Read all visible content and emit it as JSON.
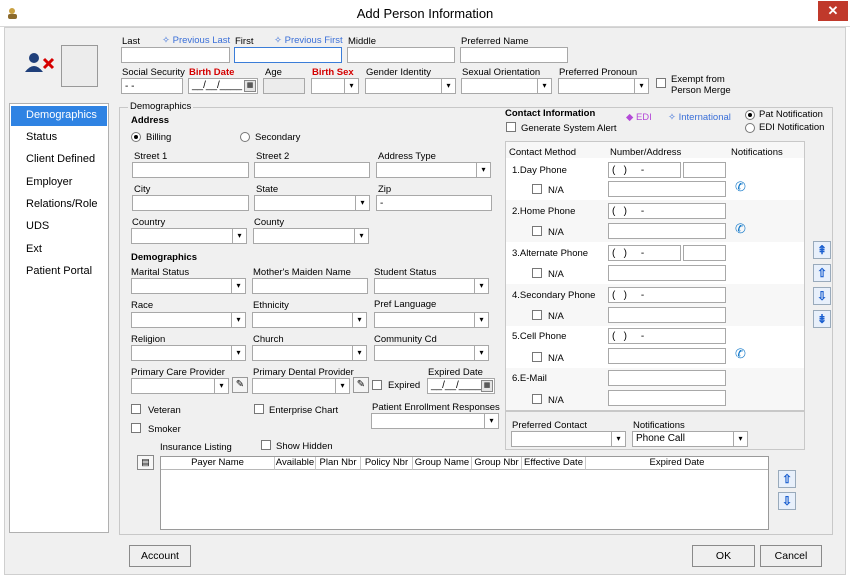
{
  "window": {
    "title": "Add Person Information",
    "close": "✕"
  },
  "top": {
    "last_label": "Last",
    "prev_last": "Previous Last",
    "first_label": "First",
    "prev_first": "Previous First",
    "middle_label": "Middle",
    "preferred_name_label": "Preferred Name",
    "ssn_label": "Social Security",
    "ssn_value": "- -",
    "birth_date_label": "Birth Date",
    "birth_date_value": "__/__/____",
    "age_label": "Age",
    "birth_sex_label": "Birth Sex",
    "gender_identity_label": "Gender Identity",
    "sexual_orientation_label": "Sexual Orientation",
    "preferred_pronoun_label": "Preferred Pronoun",
    "exempt_label": "Exempt from",
    "exempt_label2": "Person Merge"
  },
  "sidebar": {
    "items": [
      "Demographics",
      "Status",
      "Client Defined",
      "Employer",
      "Relations/Role",
      "UDS",
      "Ext",
      "Patient Portal"
    ]
  },
  "demo": {
    "group_label": "Demographics",
    "address_heading": "Address",
    "billing": "Billing",
    "secondary": "Secondary",
    "street1": "Street 1",
    "street2": "Street 2",
    "address_type": "Address Type",
    "city": "City",
    "state": "State",
    "zip": "Zip",
    "zip_value": "-",
    "country": "Country",
    "county": "County",
    "demographics_heading": "Demographics",
    "marital_status": "Marital Status",
    "mothers_maiden": "Mother's Maiden Name",
    "student_status": "Student Status",
    "race": "Race",
    "ethnicity": "Ethnicity",
    "pref_language": "Pref Language",
    "religion": "Religion",
    "church": "Church",
    "community_cd": "Community Cd",
    "primary_care": "Primary Care Provider",
    "primary_dental": "Primary Dental Provider",
    "expired_date": "Expired Date",
    "expired": "Expired",
    "expired_date_value": "__/__/____",
    "veteran": "Veteran",
    "enterprise_chart": "Enterprise Chart",
    "patient_enrollment": "Patient Enrollment Responses",
    "smoker": "Smoker"
  },
  "contact": {
    "heading": "Contact Information",
    "edi": "EDI",
    "international": "International",
    "pat_notification": "Pat Notification",
    "edi_notification": "EDI Notification",
    "generate_alert": "Generate System Alert",
    "col_method": "Contact Method",
    "col_number": "Number/Address",
    "col_notifications": "Notifications",
    "na": "N/A",
    "phone_mask": "(   )     -",
    "rows": [
      "1.Day Phone",
      "2.Home Phone",
      "3.Alternate Phone",
      "4.Secondary Phone",
      "5.Cell Phone",
      "6.E-Mail"
    ],
    "preferred_contact": "Preferred Contact",
    "notifications_label": "Notifications",
    "notifications_value": "Phone Call"
  },
  "insurance": {
    "heading": "Insurance Listing",
    "show_hidden": "Show Hidden",
    "columns": [
      "Payer Name",
      "Available",
      "Plan Nbr",
      "Policy Nbr",
      "Group Name",
      "Group Nbr",
      "Effective Date",
      "Expired Date"
    ]
  },
  "buttons": {
    "account": "Account",
    "ok": "OK",
    "cancel": "Cancel"
  },
  "colors": {
    "selected": "#2f83e3",
    "required": "#d40000",
    "link": "#3a6fd8"
  }
}
